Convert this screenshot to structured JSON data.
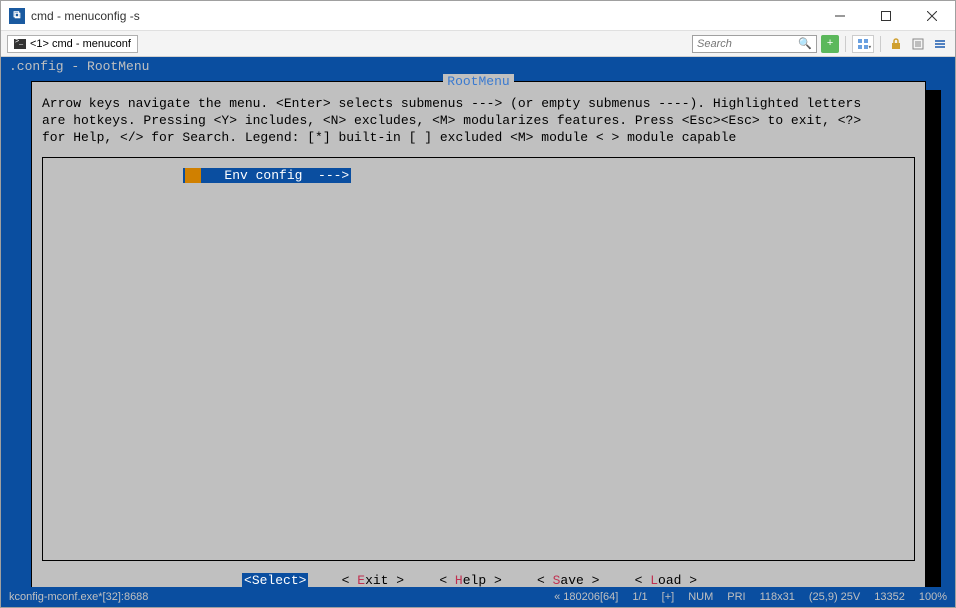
{
  "window": {
    "title": "cmd - menuconfig  -s"
  },
  "toolbar": {
    "tab_label": "<1> cmd - menuconf",
    "search_placeholder": "Search"
  },
  "terminal": {
    "header": ".config - RootMenu",
    "tui_title": " RootMenu ",
    "help_line1": "Arrow keys navigate the menu.  <Enter> selects submenus ---> (or empty submenus ----).  Highlighted letters",
    "help_line2": "are hotkeys.  Pressing <Y> includes, <N> excludes, <M> modularizes features.  Press <Esc><Esc> to exit, <?>",
    "help_line3": "for Help, </> for Search.  Legend: [*] built-in  [ ] excluded  <M> module  < > module capable",
    "menu_item_label": "Env config  --->",
    "buttons": {
      "select": "Select",
      "exit": "xit",
      "exit_hk": "E",
      "help": "elp",
      "help_hk": "H",
      "save": "ave",
      "save_hk": "S",
      "load": "oad",
      "load_hk": "L"
    }
  },
  "statusbar": {
    "left": "kconfig-mconf.exe*[32]:8688",
    "enc": "« 180206[64]",
    "pos": "1/1",
    "plus": "[+]",
    "num": "NUM",
    "pri": "PRI",
    "dim": "118x31",
    "cursor": "(25,9) 25V",
    "mem": "13352",
    "zoom": "100%"
  }
}
